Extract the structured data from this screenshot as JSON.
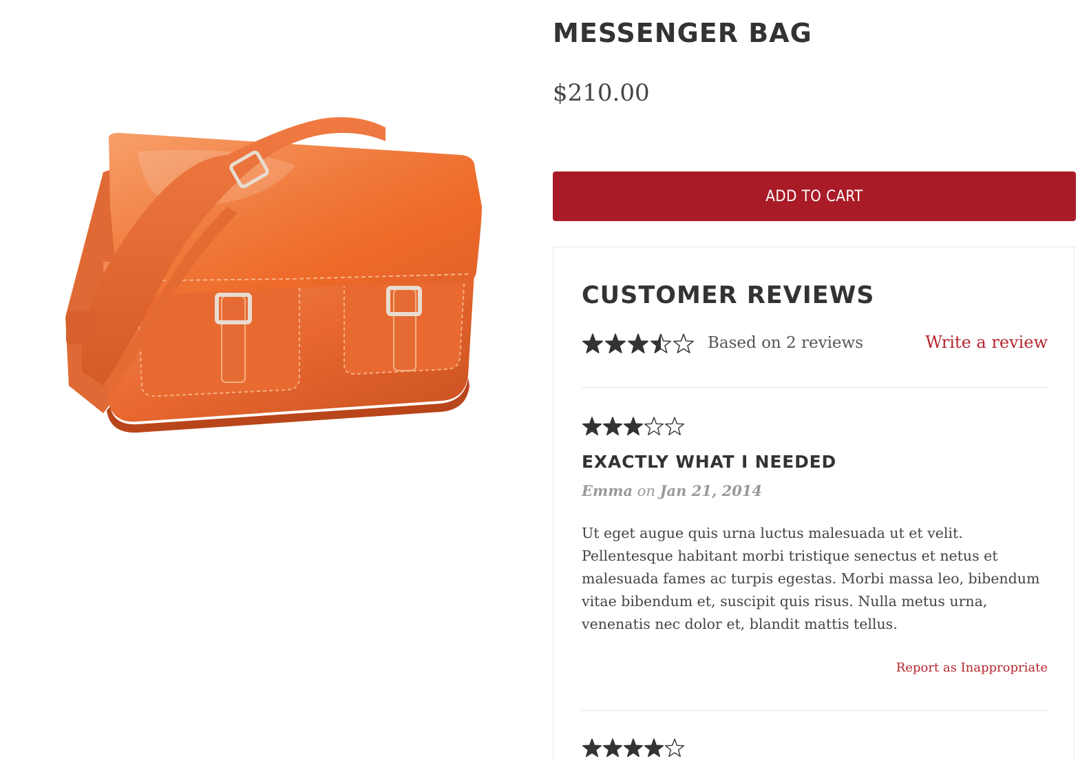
{
  "product": {
    "title": "MESSENGER BAG",
    "price": "$210.00",
    "add_to_cart_label": "ADD TO CART",
    "image_icon": "messenger-bag-image"
  },
  "colors": {
    "accent": "#a91b27",
    "link": "#b5262f",
    "star_filled": "#333333",
    "star_empty": "#333333"
  },
  "reviews": {
    "title": "CUSTOMER REVIEWS",
    "summary_rating": 3.5,
    "summary_text": "Based on 2 reviews",
    "write_review_label": "Write a review",
    "items": [
      {
        "rating": 3,
        "title": "EXACTLY WHAT I NEEDED",
        "author": "Emma",
        "on_word": "on",
        "date": "Jan 21, 2014",
        "body": "Ut eget augue quis urna luctus malesuada ut et velit. Pellentesque habitant morbi tristique senectus et netus et malesuada fames ac turpis egestas. Morbi massa leo, bibendum vitae bibendum et, suscipit quis risus. Nulla metus urna, venenatis nec dolor et, blandit mattis tellus.",
        "report_label": "Report as Inappropriate"
      },
      {
        "rating": 4
      }
    ]
  }
}
